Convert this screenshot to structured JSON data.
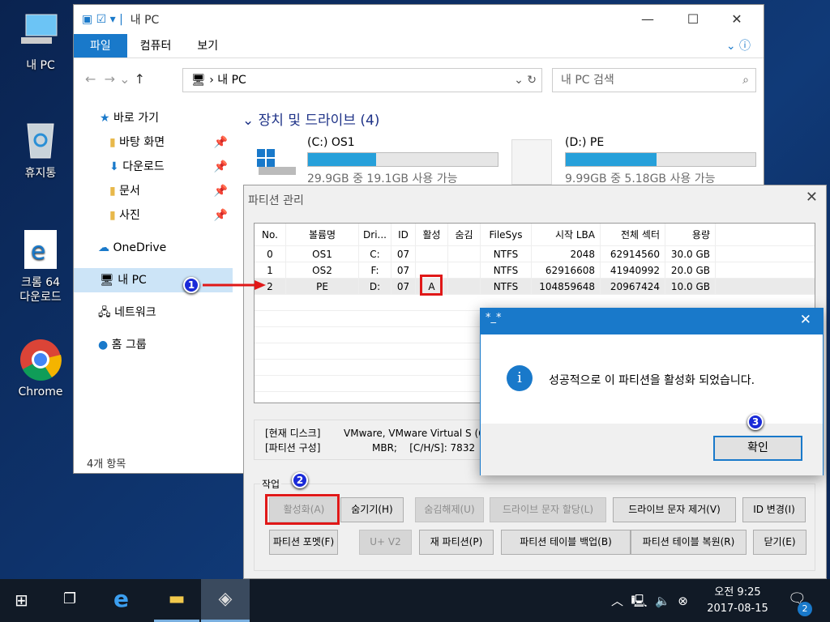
{
  "desktop": {
    "icons": [
      {
        "label": "내 PC"
      },
      {
        "label": "휴지통"
      },
      {
        "label": "크롬 64\n다운로드"
      },
      {
        "label": "Chrome"
      }
    ]
  },
  "explorer": {
    "title": "내 PC",
    "tabs": [
      "파일",
      "컴퓨터",
      "보기"
    ],
    "address": "내 PC",
    "search_placeholder": "내 PC 검색",
    "nav": [
      "바로 가기",
      "바탕 화면",
      "다운로드",
      "문서",
      "사진",
      "OneDrive",
      "내 PC",
      "네트워크",
      "홈 그룹"
    ],
    "section": "장치 및 드라이브 (4)",
    "drives": [
      {
        "name": "(C:) OS1",
        "free": "29.9GB 중 19.1GB 사용 가능",
        "used_fraction": 0.36
      },
      {
        "name": "(D:) PE",
        "free": "9.99GB 중 5.18GB 사용 가능",
        "used_fraction": 0.48
      }
    ],
    "status": "4개 항목"
  },
  "partition": {
    "title": "파티션 관리",
    "columns": [
      "No.",
      "볼륨명",
      "Dri...",
      "ID",
      "활성",
      "숨김",
      "FileSys",
      "시작 LBA",
      "전체 섹터",
      "용량"
    ],
    "rows": [
      [
        "0",
        "OS1",
        "C:",
        "07",
        "",
        "",
        "NTFS",
        "2048",
        "62914560",
        "30.0 GB"
      ],
      [
        "1",
        "OS2",
        "F:",
        "07",
        "",
        "",
        "NTFS",
        "62916608",
        "41940992",
        "20.0 GB"
      ],
      [
        "2",
        "PE",
        "D:",
        "07",
        "A",
        "",
        "NTFS",
        "104859648",
        "20967424",
        "10.0 GB"
      ]
    ],
    "info": {
      "disk_label": "[현재 디스크]",
      "disk_value": "VMware, VMware Virtual S (6",
      "layout_label": "[파티션 구성]",
      "layout_value": "MBR;    [C/H/S]: 7832"
    },
    "group": "작업",
    "buttons": [
      {
        "label": "활성화(A)",
        "enabled": false
      },
      {
        "label": "숨기기(H)",
        "enabled": true
      },
      {
        "label": "숨김해제(U)",
        "enabled": false
      },
      {
        "label": "드라이브 문자 할당(L)",
        "enabled": false
      },
      {
        "label": "드라이브 문자 제거(V)",
        "enabled": true
      },
      {
        "label": "ID 변경(I)",
        "enabled": true
      },
      {
        "label": "파티션 포멧(F)",
        "enabled": true
      },
      {
        "label": "U+ V2",
        "enabled": false
      },
      {
        "label": "재 파티션(P)",
        "enabled": true
      },
      {
        "label": "파티션 테이블 백업(B)",
        "enabled": true
      },
      {
        "label": "파티션 테이블 복원(R)",
        "enabled": true
      },
      {
        "label": "닫기(E)",
        "enabled": true
      }
    ]
  },
  "msgbox": {
    "title": "*_*",
    "message": "성공적으로 이 파티션을 활성화 되었습니다.",
    "ok": "확인"
  },
  "annotations": [
    "1",
    "2",
    "3"
  ],
  "taskbar": {
    "time": "오전 9:25",
    "date": "2017-08-15",
    "notifications": "2"
  },
  "colors": {
    "accent": "#1979ca",
    "annotation_red": "#e01818",
    "annotation_blue": "#1a2ad8"
  }
}
